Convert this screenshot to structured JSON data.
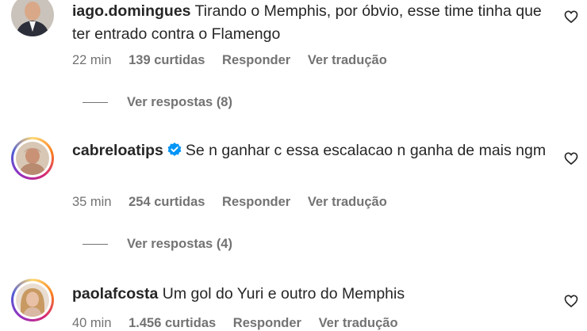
{
  "comments": [
    {
      "username": "iago.domingues",
      "text": "Tirando o Memphis, por óbvio, esse time tinha que ter entrado contra o Flamengo",
      "verified": false,
      "time": "22 min",
      "likes": "139 curtidas",
      "reply_label": "Responder",
      "translate_label": "Ver tradução",
      "view_replies": "Ver respostas (8)"
    },
    {
      "username": "cabreloatips",
      "text": "Se n ganhar c essa escalacao n ganha de mais ngm",
      "verified": true,
      "time": "35 min",
      "likes": "254 curtidas",
      "reply_label": "Responder",
      "translate_label": "Ver tradução",
      "view_replies": "Ver respostas (4)"
    },
    {
      "username": "paolafcosta",
      "text": "Um gol do Yuri e outro do Memphis",
      "verified": false,
      "time": "40 min",
      "likes": "1.456 curtidas",
      "reply_label": "Responder",
      "translate_label": "Ver tradução"
    }
  ],
  "colors": {
    "text": "#262626",
    "secondary": "#737373",
    "verified_badge": "#0095f6"
  },
  "icons": {
    "like": "heart-outline-icon",
    "verified": "verified-badge-icon"
  }
}
